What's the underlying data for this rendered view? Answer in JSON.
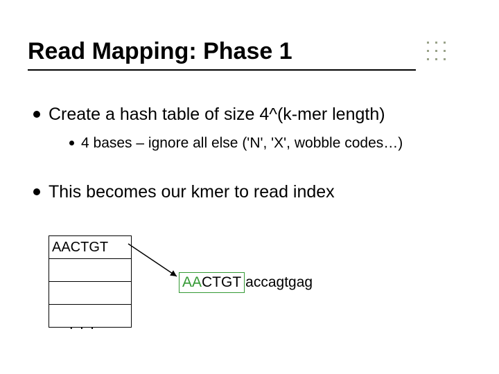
{
  "title": "Read Mapping: Phase 1",
  "bullets": {
    "item1": "Create a hash table of size 4^(k-mer length)",
    "item1_sub1": "4 bases – ignore all else ('N', 'X', wobble codes…)",
    "item2": "This becomes our kmer to read index"
  },
  "hash_table": {
    "cell0": "AACTGT",
    "ellipsis": ". . ."
  },
  "read": {
    "kmer_green": "AA",
    "kmer_black": "CTGT",
    "tail": "accagtgag"
  }
}
